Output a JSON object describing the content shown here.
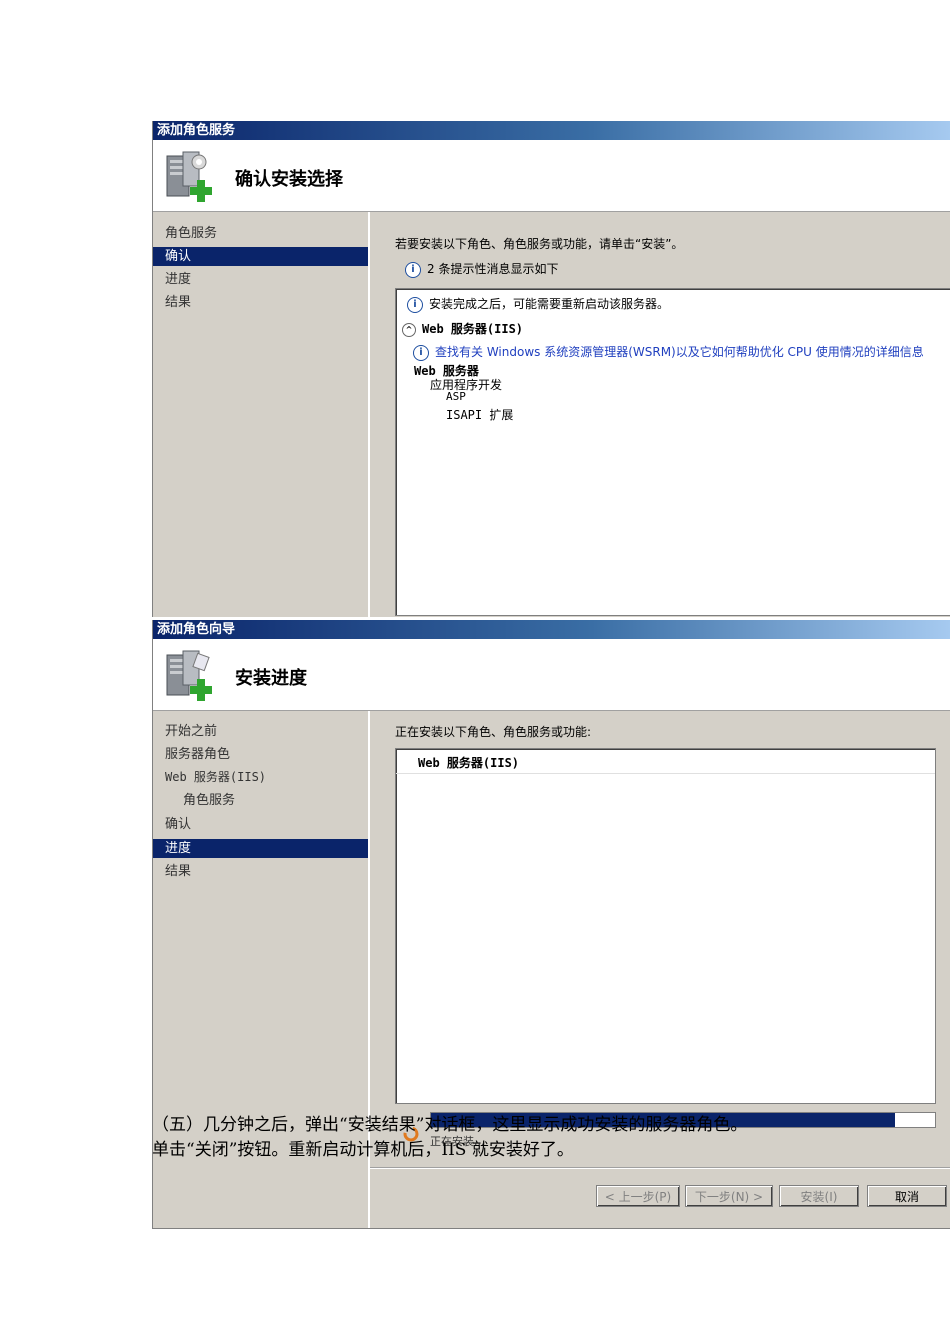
{
  "dialog1": {
    "title": "添加角色服务",
    "header_title": "确认安装选择",
    "nav": [
      "角色服务",
      "确认",
      "进度",
      "结果"
    ],
    "nav_selected_index": 1,
    "intro": "若要安装以下角色、角色服务或功能，请单击“安装”。",
    "info_count": "2 条提示性消息显示如下",
    "box": {
      "restart_notice": "安装完成之后，可能需要重新启动该服务器。",
      "group_title": "Web 服务器(IIS)",
      "link": "查找有关 Windows 系统资源管理器(WSRM)以及它如何帮助优化 CPU 使用情况的详细信息",
      "tree": [
        "Web 服务器",
        "应用程序开发",
        "ASP",
        "ISAPI 扩展"
      ]
    }
  },
  "dialog2": {
    "title": "添加角色向导",
    "header_title": "安装进度",
    "nav": [
      "开始之前",
      "服务器角色",
      "Web 服务器(IIS)",
      "角色服务",
      "确认",
      "进度",
      "结果"
    ],
    "nav_selected_index": 5,
    "intro": "正在安装以下角色、角色服务或功能:",
    "box_item": "Web 服务器(IIS)",
    "status": "正在安装...",
    "progress": 0.92,
    "buttons": {
      "back": "< 上一步(P)",
      "next": "下一步(N) >",
      "install": "安装(I)",
      "cancel": "取消"
    }
  },
  "doc_text": {
    "line1": "（五）几分钟之后，弹出“安装结果”对话框，这里显示成功安装的服务器角色。",
    "line2": "单击“关闭”按钮。重新启动计算机后，IIS 就安装好了。"
  }
}
